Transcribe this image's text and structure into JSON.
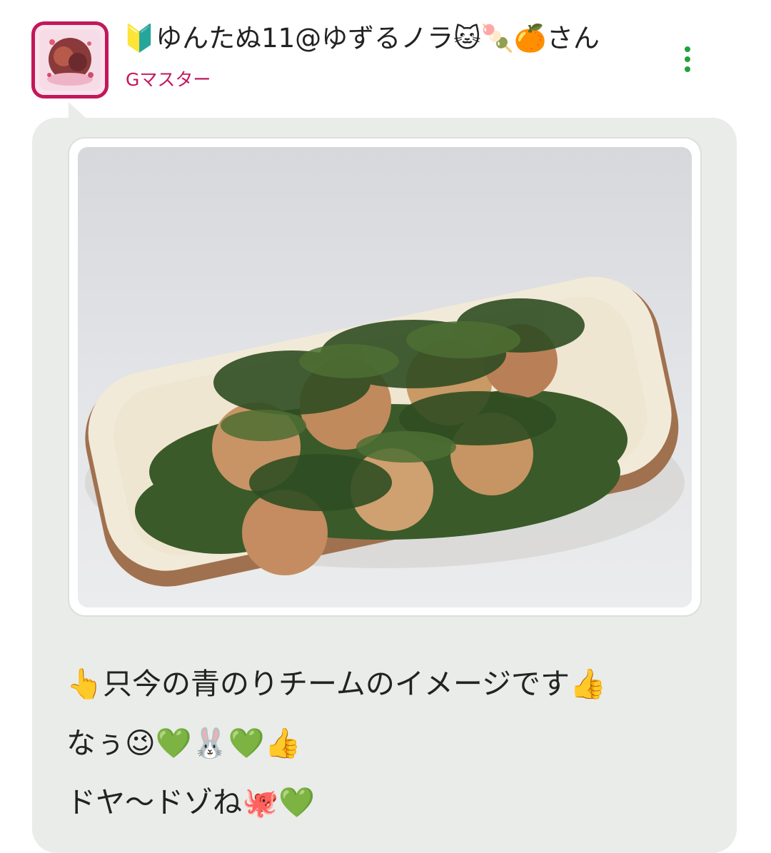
{
  "post": {
    "author": {
      "name": "🔰ゆんたぬ11@ゆずるノラ🐱🍡🍊さん",
      "rank": "Gマスター"
    },
    "caption_lines": [
      "👆只今の青のりチームのイメージです👍",
      "なぅ😉💚🐰💚👍",
      "ドヤ〜ドゾね🐙💚"
    ]
  },
  "icons": {
    "menu": "more-vert-icon"
  },
  "colors": {
    "accent": "#c2185b",
    "menu": "#1fa23a",
    "bubble": "#e9ece8"
  }
}
